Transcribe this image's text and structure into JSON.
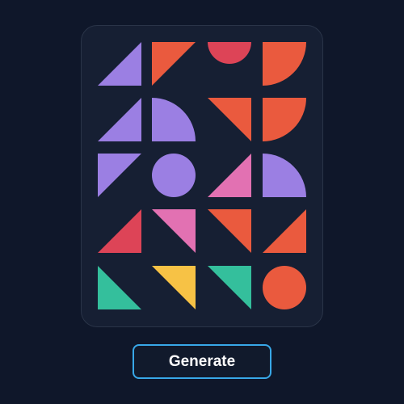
{
  "colors": {
    "purple": "#9b7fe3",
    "orange": "#ea5a3e",
    "red": "#dd4457",
    "pink": "#e271b2",
    "yellow": "#f7c245",
    "teal": "#34bf9c",
    "button_border": "#38a8e8"
  },
  "grid": {
    "rows": 5,
    "cols": 4,
    "tiles": [
      {
        "name": "triangle-bottom-right",
        "color": "purple"
      },
      {
        "name": "triangle-top-left",
        "color": "orange"
      },
      {
        "name": "half-circle-bottom",
        "color": "red"
      },
      {
        "name": "quarter-circle-top-left",
        "color": "orange"
      },
      {
        "name": "triangle-bottom-right",
        "color": "purple"
      },
      {
        "name": "quarter-circle-bottom-left",
        "color": "purple"
      },
      {
        "name": "triangle-top-right",
        "color": "orange"
      },
      {
        "name": "quarter-circle-top-left",
        "color": "orange"
      },
      {
        "name": "triangle-top-left",
        "color": "purple"
      },
      {
        "name": "circle",
        "color": "purple"
      },
      {
        "name": "triangle-bottom-right",
        "color": "pink"
      },
      {
        "name": "quarter-circle-bottom-left",
        "color": "purple"
      },
      {
        "name": "triangle-bottom-right",
        "color": "red"
      },
      {
        "name": "triangle-top-right",
        "color": "pink"
      },
      {
        "name": "triangle-top-right",
        "color": "orange"
      },
      {
        "name": "triangle-bottom-right",
        "color": "orange"
      },
      {
        "name": "triangle-bottom-left",
        "color": "teal"
      },
      {
        "name": "triangle-top-right",
        "color": "yellow"
      },
      {
        "name": "triangle-top-right",
        "color": "teal"
      },
      {
        "name": "circle",
        "color": "orange"
      }
    ]
  },
  "generate_button": {
    "label": "Generate"
  }
}
